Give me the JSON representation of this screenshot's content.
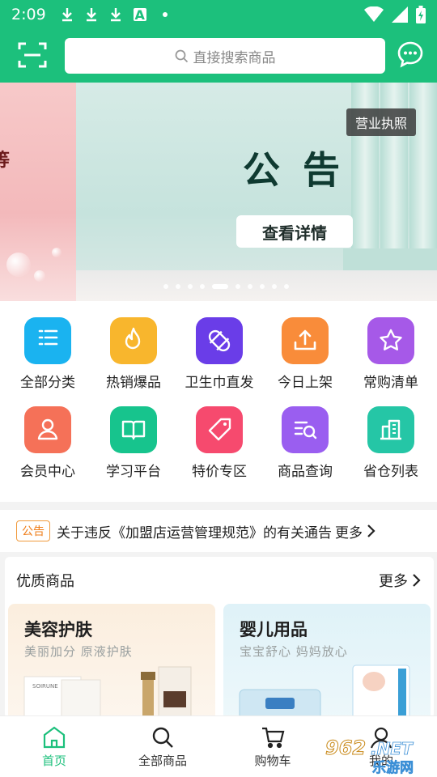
{
  "status_bar": {
    "time": "2:09",
    "a_badge": "A"
  },
  "header": {
    "search_placeholder": "直接搜索商品"
  },
  "banner": {
    "title": "公告",
    "detail_button": "查看详情",
    "license_badge": "营业执照",
    "page_count": 10,
    "active_index": 4
  },
  "categories": [
    {
      "label": "全部分类",
      "icon": "list-icon",
      "color": "#1ab3f0"
    },
    {
      "label": "热销爆品",
      "icon": "flame-icon",
      "color": "#f8b62d"
    },
    {
      "label": "卫生巾直发",
      "icon": "pad-icon",
      "color": "#6a3de8"
    },
    {
      "label": "今日上架",
      "icon": "upload-icon",
      "color": "#f98c3a"
    },
    {
      "label": "常购清单",
      "icon": "star-icon",
      "color": "#a659e8"
    },
    {
      "label": "会员中心",
      "icon": "person-icon",
      "color": "#f57158"
    },
    {
      "label": "学习平台",
      "icon": "book-icon",
      "color": "#17c48d"
    },
    {
      "label": "特价专区",
      "icon": "tag-icon",
      "color": "#f64a6e"
    },
    {
      "label": "商品查询",
      "icon": "query-icon",
      "color": "#9a5ef0"
    },
    {
      "label": "省仓列表",
      "icon": "warehouse-icon",
      "color": "#25c6a6"
    }
  ],
  "notice": {
    "tag": "公告",
    "text": "关于违反《加盟店运营管理规范》的有关通告",
    "more": "更多"
  },
  "quality": {
    "title": "优质商品",
    "more": "更多",
    "cards": [
      {
        "title": "美容护肤",
        "subtitle": "美丽加分 原液护肤"
      },
      {
        "title": "婴儿用品",
        "subtitle": "宝宝舒心 妈妈放心"
      }
    ]
  },
  "tabs": [
    {
      "label": "首页",
      "icon": "home-icon",
      "active": true
    },
    {
      "label": "全部商品",
      "icon": "search-icon",
      "active": false
    },
    {
      "label": "购物车",
      "icon": "cart-icon",
      "active": false
    },
    {
      "label": "我的",
      "icon": "user-icon",
      "active": false
    }
  ],
  "watermark": {
    "text_top": "962",
    "text_top2": ".NET",
    "text_bottom": "乐游网"
  }
}
